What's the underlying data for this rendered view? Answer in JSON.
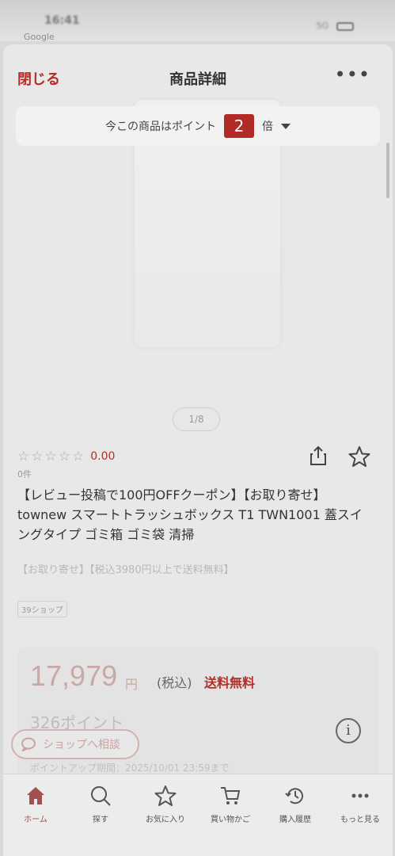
{
  "status": {
    "time": "16:41",
    "carrier": "5G",
    "back_app": "Google"
  },
  "nav": {
    "close_label": "閉じる",
    "title": "商品詳細",
    "more": "•••"
  },
  "points_banner": {
    "prefix": "今この商品はポイント",
    "multiplier": "2",
    "suffix": "倍"
  },
  "gallery": {
    "indicator": "1/8"
  },
  "rating": {
    "stars": [
      "☆",
      "☆",
      "☆",
      "☆",
      "☆"
    ],
    "score": "0.00",
    "count": "0件"
  },
  "product": {
    "title": "【レビュー投稿で100円OFFクーポン】【お取り寄せ】townew スマートトラッシュボックス T1 TWN1001 蓋スイングタイプ ゴミ箱 ゴミ袋 清掃",
    "tags": "【お取り寄せ】【税込3980円以上で送料無料】",
    "shop_badge": "39ショップ"
  },
  "price": {
    "amount": "17,979",
    "yen": "円",
    "tax": "(税込)",
    "free_shipping": "送料無料",
    "points": "326ポイント",
    "points_period": "ポイントアップ期間：2025/10/01 23:59まで"
  },
  "consult": {
    "label": "ショップへ相談"
  },
  "tabbar": {
    "items": [
      {
        "label": "ホーム",
        "icon": "home-icon"
      },
      {
        "label": "探す",
        "icon": "search-icon"
      },
      {
        "label": "お気に入り",
        "icon": "star-icon"
      },
      {
        "label": "買い物かご",
        "icon": "cart-icon"
      },
      {
        "label": "購入履歴",
        "icon": "history-icon"
      },
      {
        "label": "もっと見る",
        "icon": "more-icon"
      }
    ]
  },
  "colors": {
    "accent": "#b32e2a",
    "background": "#e8e8e8"
  }
}
